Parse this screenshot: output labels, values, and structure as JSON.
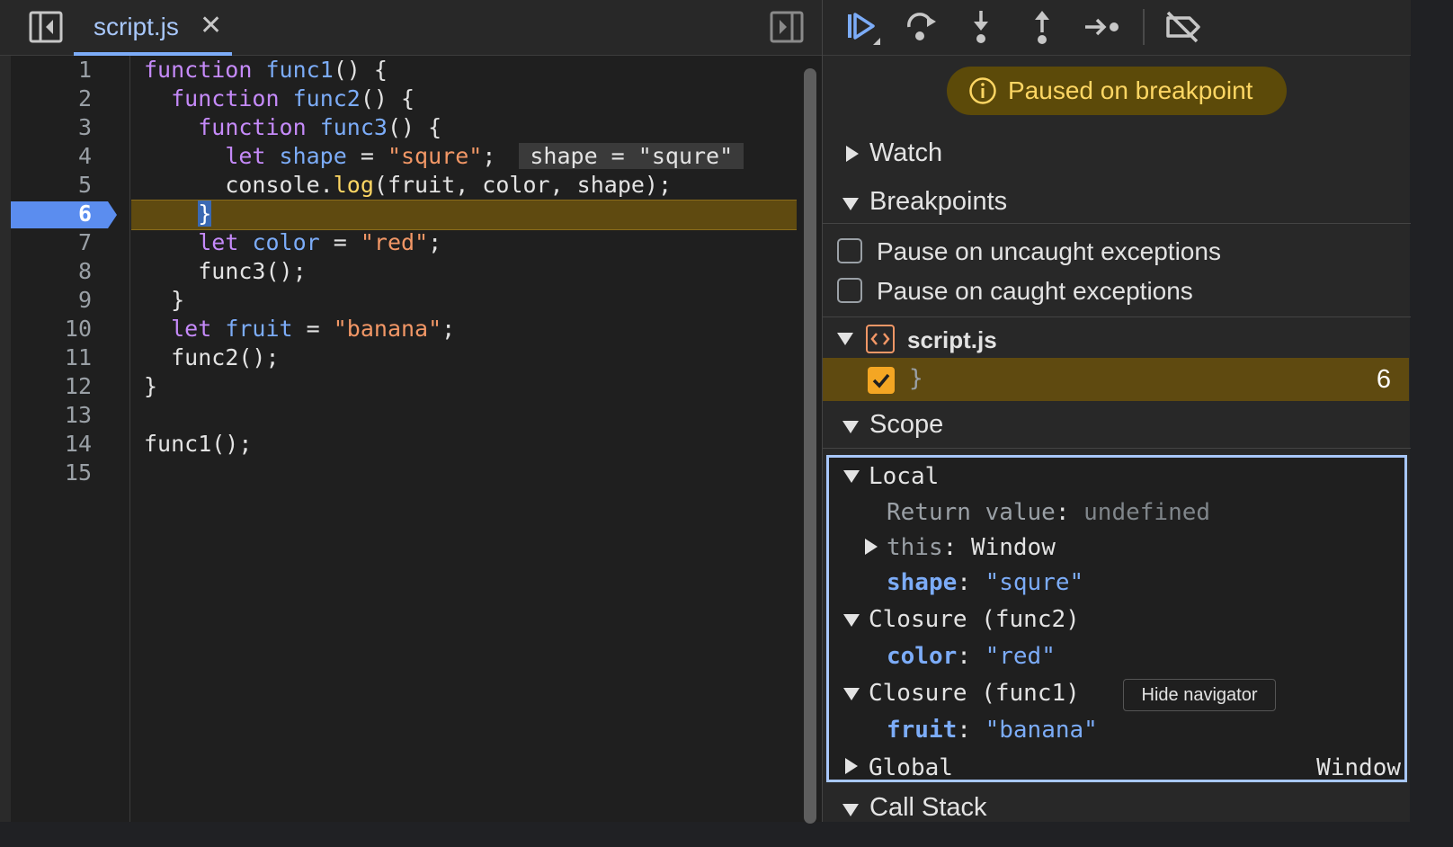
{
  "editor": {
    "tab_label": "script.js",
    "tab_close": "✕",
    "line_numbers": [
      "1",
      "2",
      "3",
      "4",
      "5",
      "6",
      "7",
      "8",
      "9",
      "10",
      "11",
      "12",
      "13",
      "14",
      "15"
    ],
    "active_line": "6",
    "code": {
      "l1": {
        "kw": "function",
        "fn": "func1",
        "rest": "() {"
      },
      "l2": {
        "kw": "function",
        "fn": "func2",
        "rest": "() {"
      },
      "l3": {
        "kw": "function",
        "fn": "func3",
        "rest": "() {"
      },
      "l4": {
        "kw": "let",
        "var": "shape",
        "eq": " = ",
        "str": "\"squre\"",
        "semi": ";",
        "inline": "shape = \"squre\""
      },
      "l5": {
        "obj": "console.",
        "meth": "log",
        "rest": "(fruit, color, shape);"
      },
      "l6": {
        "brace": "}"
      },
      "l7": {
        "kw": "let",
        "var": "color",
        "eq": " = ",
        "str": "\"red\"",
        "semi": ";"
      },
      "l8": {
        "text": "func3();"
      },
      "l9": {
        "text": "}"
      },
      "l10": {
        "kw": "let",
        "var": "fruit",
        "eq": " = ",
        "str": "\"banana\"",
        "semi": ";"
      },
      "l11": {
        "text": "func2();"
      },
      "l12": {
        "text": "}"
      },
      "l14": {
        "text": "func1();"
      }
    }
  },
  "debugger": {
    "paused_text": "Paused on breakpoint",
    "sections": {
      "watch": "Watch",
      "breakpoints": "Breakpoints",
      "scope": "Scope",
      "call_stack": "Call Stack"
    },
    "pause_options": [
      {
        "label": "Pause on uncaught exceptions",
        "checked": false
      },
      {
        "label": "Pause on caught exceptions",
        "checked": false
      }
    ],
    "bp_file": "script.js",
    "bp_entry": {
      "code": "}",
      "line": "6",
      "checked": true
    },
    "scope": {
      "local_title": "Local",
      "return_key": "Return value",
      "return_val": "undefined",
      "this_key": "this",
      "this_val": "Window",
      "shape_key": "shape",
      "shape_val": "\"squre\"",
      "closure2_title": "Closure (func2)",
      "color_key": "color",
      "color_val": "\"red\"",
      "closure1_title": "Closure (func1)",
      "fruit_key": "fruit",
      "fruit_val": "\"banana\"",
      "global_title": "Global",
      "global_val": "Window"
    },
    "tooltip": "Hide navigator"
  },
  "colors": {
    "accent_blue": "#7cacf8",
    "paused_yellow": "#fdd663",
    "breakpoint_highlight": "#5f4a10",
    "checkbox_orange": "#f4a623"
  }
}
